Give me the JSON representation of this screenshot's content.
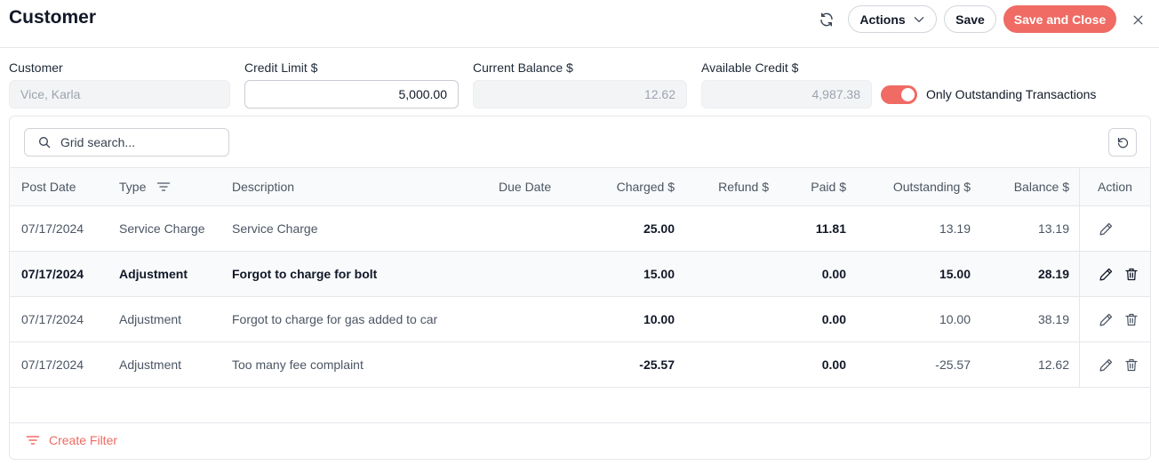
{
  "header": {
    "title": "Customer",
    "actions_label": "Actions",
    "save_label": "Save",
    "save_close_label": "Save and Close"
  },
  "form": {
    "customer_label": "Customer",
    "customer_value": "Vice, Karla",
    "credit_limit_label": "Credit Limit $",
    "credit_limit_value": "5,000.00",
    "current_balance_label": "Current Balance $",
    "current_balance_value": "12.62",
    "available_credit_label": "Available Credit $",
    "available_credit_value": "4,987.38",
    "outstanding_toggle_label": "Only Outstanding Transactions",
    "outstanding_toggle_on": true
  },
  "grid": {
    "search_placeholder": "Grid search...",
    "columns": {
      "post_date": "Post Date",
      "type": "Type",
      "description": "Description",
      "due_date": "Due Date",
      "charged": "Charged $",
      "refund": "Refund $",
      "paid": "Paid $",
      "outstanding": "Outstanding $",
      "balance": "Balance $",
      "action": "Action"
    },
    "rows": [
      {
        "post_date": "07/17/2024",
        "type": "Service Charge",
        "description": "Service Charge",
        "due_date": "",
        "charged": "25.00",
        "refund": "",
        "paid": "11.81",
        "outstanding": "13.19",
        "balance": "13.19"
      },
      {
        "post_date": "07/17/2024",
        "type": "Adjustment",
        "description": "Forgot to charge for bolt",
        "due_date": "",
        "charged": "15.00",
        "refund": "",
        "paid": "0.00",
        "outstanding": "15.00",
        "balance": "28.19"
      },
      {
        "post_date": "07/17/2024",
        "type": "Adjustment",
        "description": "Forgot to charge for gas added to car",
        "due_date": "",
        "charged": "10.00",
        "refund": "",
        "paid": "0.00",
        "outstanding": "10.00",
        "balance": "38.19"
      },
      {
        "post_date": "07/17/2024",
        "type": "Adjustment",
        "description": "Too many fee complaint",
        "due_date": "",
        "charged": "-25.57",
        "refund": "",
        "paid": "0.00",
        "outstanding": "-25.57",
        "balance": "12.62"
      }
    ],
    "create_filter_label": "Create Filter"
  },
  "colors": {
    "accent": "#ef6b63",
    "border": "#e5e7eb",
    "muted_text": "#4b5563"
  }
}
